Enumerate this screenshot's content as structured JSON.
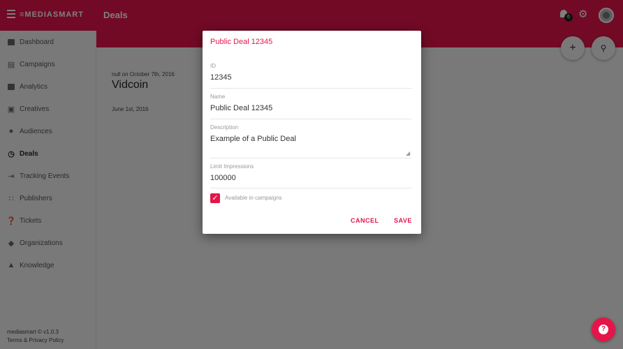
{
  "header": {
    "logo": "≡MEDIASMART",
    "title": "Deals",
    "notification_count": "6"
  },
  "sidebar": {
    "items": [
      {
        "label": "Dashboard",
        "icon": "dashboard-icon"
      },
      {
        "label": "Campaigns",
        "icon": "campaigns-icon"
      },
      {
        "label": "Analytics",
        "icon": "analytics-icon"
      },
      {
        "label": "Creatives",
        "icon": "creatives-icon"
      },
      {
        "label": "Audiences",
        "icon": "audiences-icon"
      },
      {
        "label": "Deals",
        "icon": "deals-icon",
        "active": true
      },
      {
        "label": "Tracking Events",
        "icon": "tracking-events-icon"
      },
      {
        "label": "Publishers",
        "icon": "publishers-icon"
      },
      {
        "label": "Tickets",
        "icon": "tickets-icon"
      },
      {
        "label": "Organizations",
        "icon": "organizations-icon"
      },
      {
        "label": "Knowledge",
        "icon": "knowledge-icon"
      }
    ],
    "footer_version": "mediasmart © v1.0.3",
    "footer_link": "Terms & Privacy Policy"
  },
  "card": {
    "meta": "null on October 7th, 2016",
    "name": "Vidcoin",
    "date": "June 1st, 2016"
  },
  "dialog": {
    "title": "Public Deal 12345",
    "fields": {
      "id": {
        "label": "ID",
        "value": "12345"
      },
      "name": {
        "label": "Name",
        "value": "Public Deal 12345"
      },
      "description": {
        "label": "Description",
        "value": "Example of a Public Deal"
      },
      "limit": {
        "label": "Limit Impressions",
        "value": "100000"
      }
    },
    "checkbox_label": "Available in campaigns",
    "checkbox_checked": true,
    "cancel_label": "CANCEL",
    "save_label": "SAVE"
  },
  "colors": {
    "brand": "#e5154a"
  }
}
